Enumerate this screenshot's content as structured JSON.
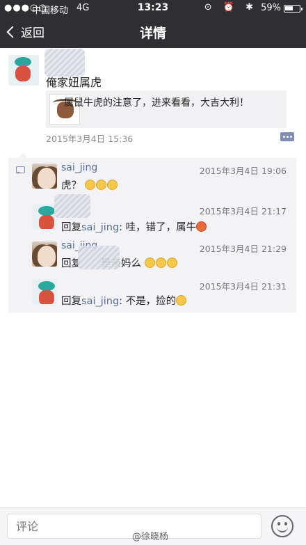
{
  "status": {
    "signal": "●●●○○",
    "carrier": "中国移动",
    "network": "4G",
    "time": "13:23",
    "icons": "⊙ ⏰ ✱",
    "battery": "59%",
    "battery_level": 0.59
  },
  "nav": {
    "back_label": "返回",
    "title": "详情"
  },
  "post": {
    "text": "俺家妞属虎",
    "share_text": "属鼠牛虎的注意了，进来看看，大吉大利！",
    "time": "2015年3月4日 15:36"
  },
  "comments": [
    {
      "name": "sai_jing",
      "time": "2015年3月4日 19:06",
      "text": "虎？"
    },
    {
      "reply_prefix": "回复",
      "reply_to": "sai_jing",
      "time": "2015年3月4日 21:17",
      "text": ": 哇，错了，属牛"
    },
    {
      "name": "sai_jing",
      "time": "2015年3月4日 21:29",
      "reply_prefix": "回复",
      "text": "是亲妈么"
    },
    {
      "reply_prefix": "回复",
      "reply_to": "sai_jing",
      "time": "2015年3月4日 21:31",
      "text": ": 不是，捡的"
    }
  ],
  "input": {
    "placeholder": "评论"
  },
  "watermark": "@徐晓杨"
}
